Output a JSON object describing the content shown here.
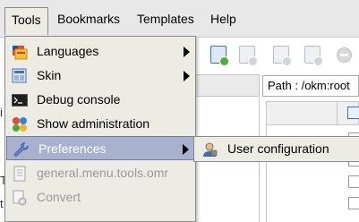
{
  "menubar": {
    "items": [
      {
        "label": "Tools",
        "active": true
      },
      {
        "label": "Bookmarks"
      },
      {
        "label": "Templates"
      },
      {
        "label": "Help"
      }
    ]
  },
  "tools_menu": {
    "items": [
      {
        "label": "Languages",
        "icon": "languages-icon",
        "submenu": true,
        "enabled": true
      },
      {
        "label": "Skin",
        "icon": "skin-icon",
        "submenu": true,
        "enabled": true
      },
      {
        "label": "Debug console",
        "icon": "console-icon",
        "submenu": false,
        "enabled": true
      },
      {
        "label": "Show administration",
        "icon": "administration-icon",
        "submenu": false,
        "enabled": true
      },
      {
        "label": "Preferences",
        "icon": "wrench-icon",
        "submenu": true,
        "enabled": true,
        "highlighted": true
      },
      {
        "label": "general.menu.tools.omr",
        "icon": "omr-icon",
        "submenu": false,
        "enabled": false
      },
      {
        "label": "Convert",
        "icon": "convert-icon",
        "submenu": false,
        "enabled": false
      }
    ]
  },
  "preferences_submenu": {
    "items": [
      {
        "label": "User configuration",
        "icon": "user-config-icon"
      }
    ]
  },
  "path_bar": {
    "text": "Path : /okm:root"
  },
  "background_fragments": {
    "left_i": "i",
    "left_t": "T",
    "left_t2": "t"
  },
  "colors": {
    "menu_bg": "#ecebe4",
    "highlight_bg": "#a8b2cf",
    "disabled_text": "#9a9a9a"
  }
}
